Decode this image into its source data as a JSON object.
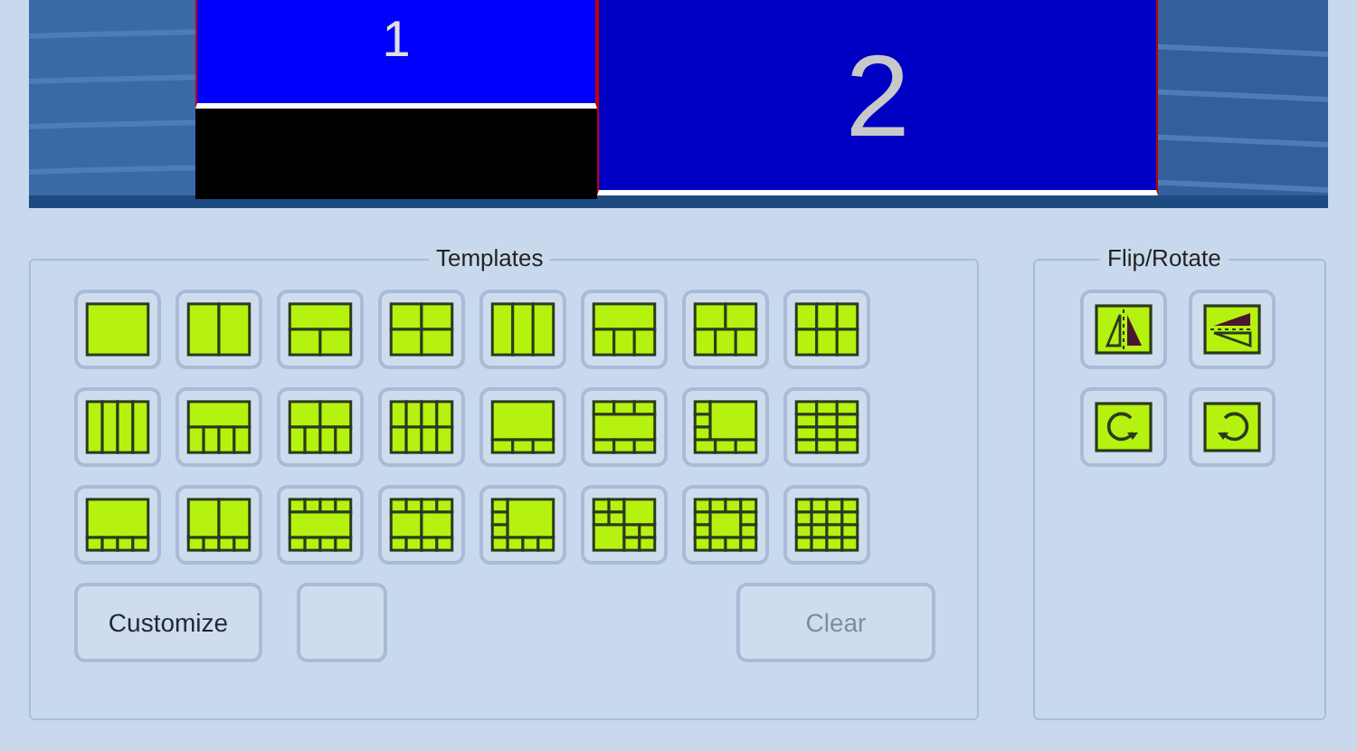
{
  "preview": {
    "monitors": [
      {
        "label": "1"
      },
      {
        "label": "2"
      }
    ]
  },
  "templates": {
    "title": "Templates",
    "items": [
      {
        "kind": "single"
      },
      {
        "kind": "col2"
      },
      {
        "kind": "t1b2"
      },
      {
        "kind": "g2x2"
      },
      {
        "kind": "col3"
      },
      {
        "kind": "t1b3"
      },
      {
        "kind": "t2b3"
      },
      {
        "kind": "g3x2"
      },
      {
        "kind": "col4"
      },
      {
        "kind": "t1b4"
      },
      {
        "kind": "t2b4"
      },
      {
        "kind": "g4x2"
      },
      {
        "kind": "big_b3"
      },
      {
        "kind": "t3_big_b3"
      },
      {
        "kind": "l_big_b3"
      },
      {
        "kind": "g3x4"
      },
      {
        "kind": "big_b4"
      },
      {
        "kind": "t2_b4"
      },
      {
        "kind": "t4_big_b4"
      },
      {
        "kind": "t4_m2_b4"
      },
      {
        "kind": "l_big_b4"
      },
      {
        "kind": "mixed"
      },
      {
        "kind": "frame"
      },
      {
        "kind": "g4x4"
      }
    ],
    "buttons": [
      {
        "kind": "text",
        "label": "Customize",
        "disabled": false
      },
      {
        "kind": "blank"
      },
      {
        "kind": "text",
        "label": "Clear",
        "disabled": true
      }
    ]
  },
  "flip_rotate": {
    "title": "Flip/Rotate",
    "items": [
      {
        "kind": "flip-horizontal"
      },
      {
        "kind": "flip-vertical"
      },
      {
        "kind": "rotate-clockwise"
      },
      {
        "kind": "rotate-counterclockwise"
      }
    ]
  }
}
